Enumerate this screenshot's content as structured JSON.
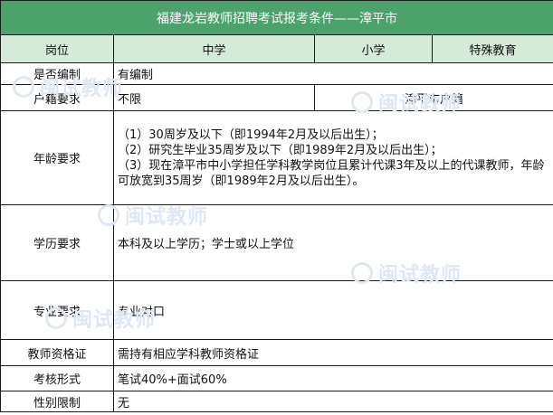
{
  "title": "福建龙岩教师招聘考试报考条件——漳平市",
  "header": {
    "col0": "岗位",
    "col1": "中学",
    "col2": "小学",
    "col3": "特殊教育"
  },
  "rows": {
    "bianzhi": {
      "label": "是否编制",
      "value": "有编制"
    },
    "huji": {
      "label": "户籍要求",
      "value_left": "不限",
      "value_right": "漳平市户籍"
    },
    "nianling": {
      "label": "年龄要求",
      "lines": [
        "（1）30周岁及以下（即1994年2月及以后出生）；",
        "（2）研究生毕业35周岁及以下（即1989年2月及以后出生）；",
        "（3）现在漳平市中小学担任学科教学岗位且累计代课3年及以上的代课教师，年龄可放宽到35周岁（即1989年2月及以后出生）。"
      ]
    },
    "xueli": {
      "label": "学历要求",
      "value": "本科及以上学历；学士或以上学位"
    },
    "zhuanye": {
      "label": "专业要求",
      "value": "专业对口"
    },
    "zige": {
      "label": "教师资格证",
      "value": "需持有相应学科教师资格证"
    },
    "kaohe": {
      "label": "考核形式",
      "value": "笔试40%+面试60%"
    },
    "xingbie": {
      "label": "性别限制",
      "value": "无"
    }
  },
  "watermark": {
    "text": "闽试教师"
  },
  "colors": {
    "title_bg": "#4ca26b",
    "header_bg": "#d6ead9",
    "border": "#1a1a1a",
    "watermark": "#dfe7f3"
  }
}
